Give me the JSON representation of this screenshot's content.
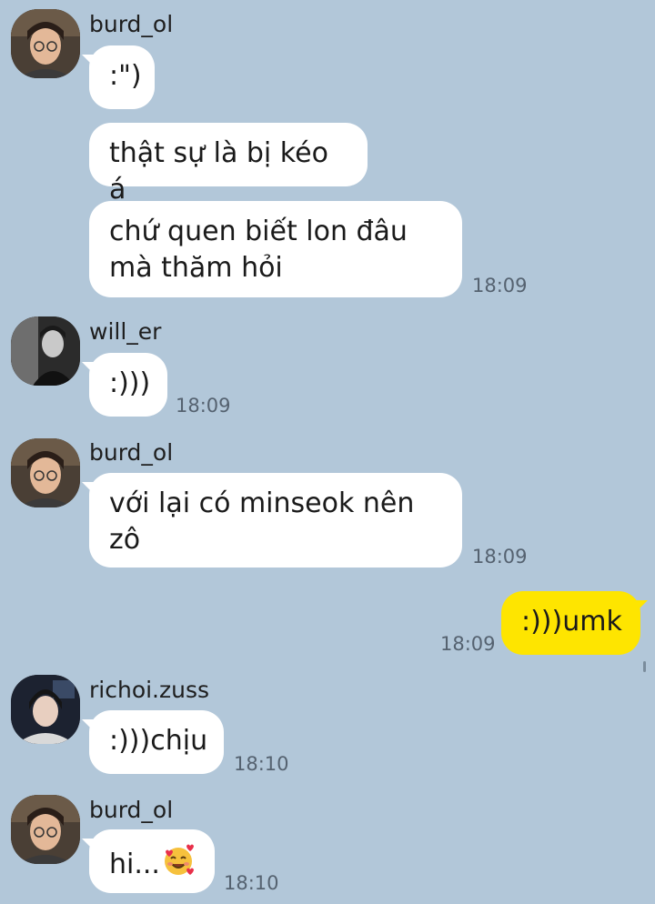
{
  "messages": [
    {
      "sender": "burd_ol",
      "avatar": "avatar-burd-ol",
      "lines": [
        ":\")",
        "thật sự là bị kéo á",
        "chứ quen biết lon đâu\nmà thăm hỏi"
      ],
      "time": "18:09"
    },
    {
      "sender": "will_er",
      "avatar": "avatar-will-er",
      "lines": [
        ":)))"
      ],
      "time": "18:09"
    },
    {
      "sender": "burd_ol",
      "avatar": "avatar-burd-ol",
      "lines": [
        "với lại có minseok nên\nzô"
      ],
      "time": "18:09"
    },
    {
      "sender": "me",
      "lines": [
        ":)))umk"
      ],
      "time": "18:09"
    },
    {
      "sender": "richoi.zuss",
      "avatar": "avatar-richoi-zuss",
      "lines": [
        ":)))chịu"
      ],
      "time": "18:10"
    },
    {
      "sender": "burd_ol",
      "avatar": "avatar-burd-ol",
      "lines": [
        "hi..."
      ],
      "emoji": "smiling-face-with-hearts-icon",
      "time": "18:10"
    }
  ],
  "colors": {
    "background": "#b2c7d9",
    "incoming_bubble": "#ffffff",
    "outgoing_bubble": "#fee500"
  }
}
